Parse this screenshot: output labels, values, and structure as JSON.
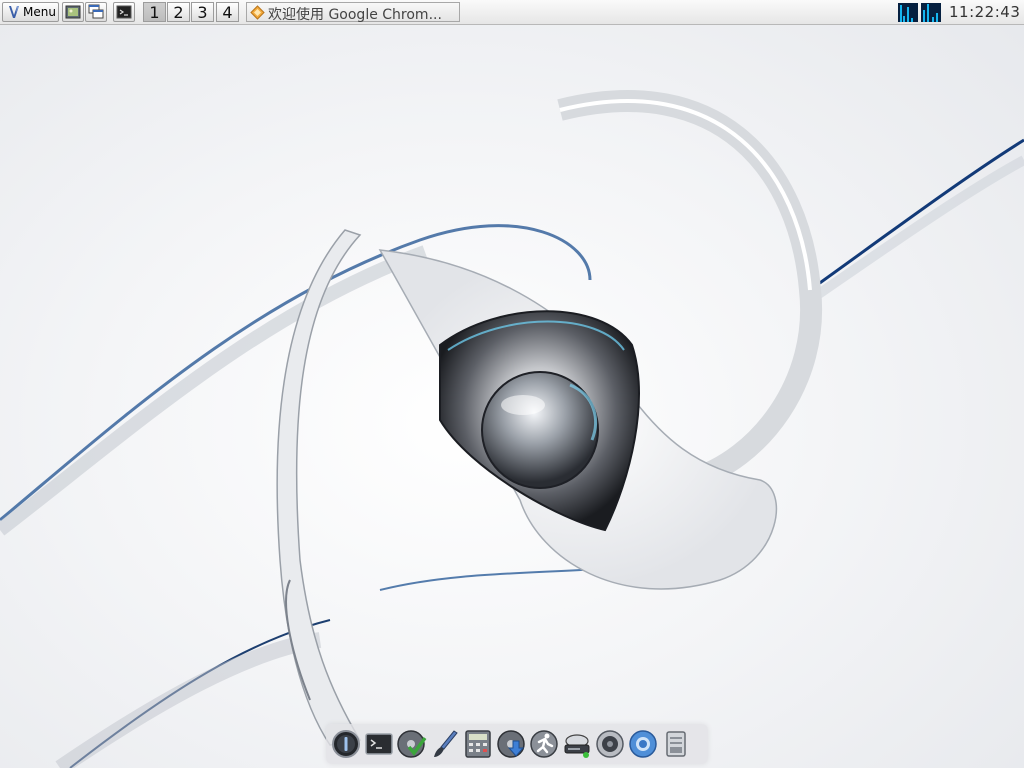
{
  "top_panel": {
    "menu": {
      "label": "Menu",
      "icon": "menu-logo-icon"
    },
    "quick_launchers": [
      {
        "name": "show-desktop",
        "icon": "image-viewer-icon"
      },
      {
        "name": "window-switcher",
        "icon": "window-list-icon"
      },
      {
        "name": "terminal",
        "icon": "terminal-icon"
      }
    ],
    "workspaces": [
      {
        "label": "1",
        "active": true
      },
      {
        "label": "2",
        "active": false
      },
      {
        "label": "3",
        "active": false
      },
      {
        "label": "4",
        "active": false
      }
    ],
    "taskbar": [
      {
        "title": "欢迎使用 Google Chrom...",
        "icon": "chrome-app-icon"
      }
    ],
    "system_monitor": {
      "icon": "cpu-monitor-icon"
    },
    "clock": "11:22:43"
  },
  "dock": {
    "items": [
      {
        "name": "power",
        "icon": "power-icon"
      },
      {
        "name": "terminal",
        "icon": "terminal-icon"
      },
      {
        "name": "package-manager",
        "icon": "checkmark-disc-icon"
      },
      {
        "name": "paint",
        "icon": "paintbrush-icon"
      },
      {
        "name": "calculator",
        "icon": "calculator-icon"
      },
      {
        "name": "download",
        "icon": "download-disc-icon"
      },
      {
        "name": "system-monitor",
        "icon": "runner-icon"
      },
      {
        "name": "drive",
        "icon": "hard-drive-icon"
      },
      {
        "name": "media",
        "icon": "speaker-icon"
      },
      {
        "name": "browser",
        "icon": "browser-icon"
      },
      {
        "name": "files",
        "icon": "document-icon"
      }
    ]
  },
  "colors": {
    "panel_bg": "#eeeeee",
    "accent_blue": "#0d3a7a",
    "monitor_bar": "#16b6f0",
    "monitor_bg": "#062040"
  }
}
